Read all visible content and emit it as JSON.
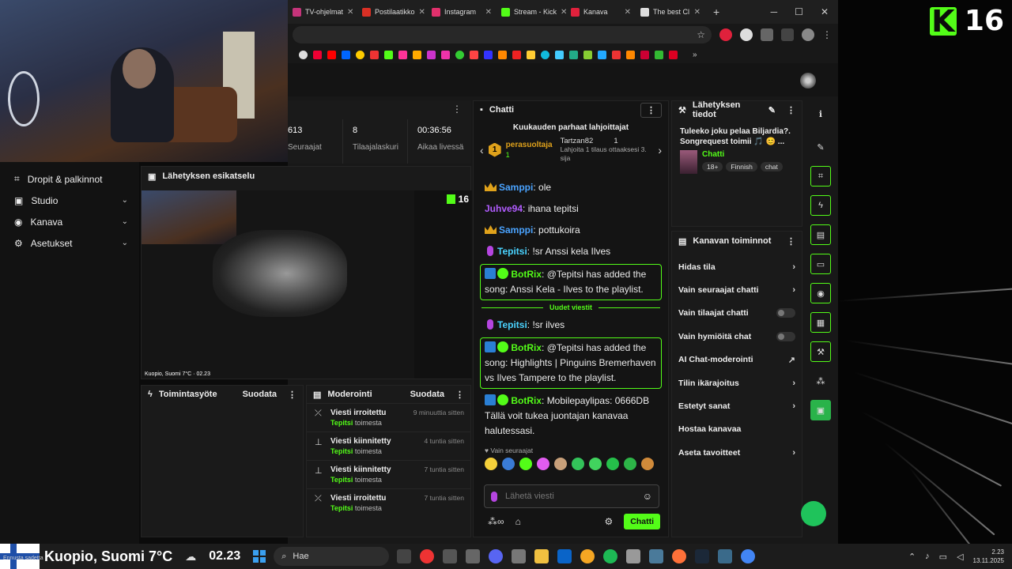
{
  "overlay": {
    "number": "16"
  },
  "browser": {
    "tabs": [
      {
        "label": "TV-ohjelmat",
        "color": "#c5347a"
      },
      {
        "label": "Postilaatikko",
        "color": "#d93025"
      },
      {
        "label": "Instagram",
        "color": "#e1306c"
      },
      {
        "label": "Stream - Kick",
        "color": "#53fc18"
      },
      {
        "label": "Kanava",
        "color": "#e0213c"
      },
      {
        "label": "The best Cl",
        "color": "#dddddd"
      }
    ],
    "new_tab": "+",
    "controls": {
      "minimize": "─",
      "maximize": "☐",
      "close": "✕"
    }
  },
  "sidebar": {
    "items": [
      {
        "label": "Dropit & palkinnot",
        "icon": "gift-icon"
      },
      {
        "label": "Studio",
        "icon": "studio-icon"
      },
      {
        "label": "Kanava",
        "icon": "channel-icon"
      },
      {
        "label": "Asetukset",
        "icon": "gear-icon"
      }
    ]
  },
  "stats": {
    "items": [
      {
        "value": "613",
        "label": "Seuraajat"
      },
      {
        "value": "8",
        "label": "Tilaajalaskuri"
      },
      {
        "value": "00:36:56",
        "label": "Aikaa livessä"
      }
    ]
  },
  "preview": {
    "title": "Lähetyksen esikatselu",
    "badge": "16",
    "weather": "Kuopio, Suomi 7°C · 02.23"
  },
  "activity": {
    "title": "Toimintasyöte",
    "filter": "Suodata"
  },
  "moderation": {
    "title": "Moderointi",
    "filter": "Suodata",
    "items": [
      {
        "title": "Viesti irroitettu",
        "user": "Tepitsi",
        "suffix": "toimesta",
        "time": "9 minuuttia sitten",
        "icon": "unpin-icon"
      },
      {
        "title": "Viesti kiinnitetty",
        "user": "Tepitsi",
        "suffix": "toimesta",
        "time": "4 tuntia sitten",
        "icon": "pin-icon"
      },
      {
        "title": "Viesti kiinnitetty",
        "user": "Tepitsi",
        "suffix": "toimesta",
        "time": "7 tuntia sitten",
        "icon": "pin-icon"
      },
      {
        "title": "Viesti irroitettu",
        "user": "Tepitsi",
        "suffix": "toimesta",
        "time": "7 tuntia sitten",
        "icon": "unpin-icon"
      }
    ]
  },
  "chat": {
    "title": "Chatti",
    "gifters_title": "Kuukauden parhaat lahjoittajat",
    "gifter1": {
      "rank": "1",
      "name": "perasuoltaja",
      "count": "1"
    },
    "gifter2": {
      "name": "Tartzan82",
      "count": "1",
      "sub": "Lahjoita 1 tilaus ottaaksesi 3. sija"
    },
    "messages": [
      {
        "user": "Samppi",
        "text": "ole",
        "color": "#4aa3ff",
        "badge": "crown"
      },
      {
        "user": "Juhve94",
        "text": "ihana tepitsi",
        "color": "#b15cff",
        "badge": "none"
      },
      {
        "user": "Samppi",
        "text": "pottukoira",
        "color": "#4aa3ff",
        "badge": "crown"
      },
      {
        "user": "Tepitsi",
        "text": "!sr Anssi kela Ilves",
        "color": "#4ad3ff",
        "badge": "mic"
      }
    ],
    "bot1": {
      "user": "BotRix",
      "text": "@Tepitsi has added the song: Anssi Kela - Ilves to the playlist."
    },
    "new_messages": "Uudet viestit",
    "msg_after": {
      "user": "Tepitsi",
      "text": "!sr ilves"
    },
    "bot2": {
      "user": "BotRix",
      "text": "@Tepitsi has added the song: Highlights | Pinguins Bremerhaven vs Ilves Tampere to the playlist."
    },
    "bot3": {
      "user": "BotRix",
      "text": "Mobilepaylipas: 0666DB Tällä voit tukea juontajan kanavaa halutessasi."
    },
    "followers_only": "♥ Vain seuraajat",
    "input_placeholder": "Lähetä viesti",
    "send": "Chatti"
  },
  "stream_info": {
    "title": "Lähetyksen tiedot",
    "text": "Tuleeko joku pelaa Biljardia?. Songrequest toimii 🎵 😊 ...",
    "category": "Chatti",
    "tags": [
      "18+",
      "Finnish",
      "chat"
    ]
  },
  "channel_actions": {
    "title": "Kanavan toiminnot",
    "items": [
      {
        "label": "Hidas tila",
        "kind": "chevron"
      },
      {
        "label": "Vain seuraajat chatti",
        "kind": "chevron"
      },
      {
        "label": "Vain tilaajat chatti",
        "kind": "toggle"
      },
      {
        "label": "Vain hymiöitä chat",
        "kind": "toggle"
      },
      {
        "label": "AI Chat-moderointi",
        "kind": "external"
      },
      {
        "label": "Tilin ikärajoitus",
        "kind": "chevron"
      },
      {
        "label": "Estetyt sanat",
        "kind": "chevron"
      },
      {
        "label": "Hostaa kanavaa",
        "kind": "none"
      },
      {
        "label": "Aseta tavoitteet",
        "kind": "chevron"
      }
    ]
  },
  "taskbar": {
    "weather": "Kuopio, Suomi 7°C",
    "weather_sub": "Ennusta sadetta",
    "time": "02.23",
    "search": "Hae",
    "clock_time": "2.23",
    "clock_date": "13.11.2025"
  }
}
